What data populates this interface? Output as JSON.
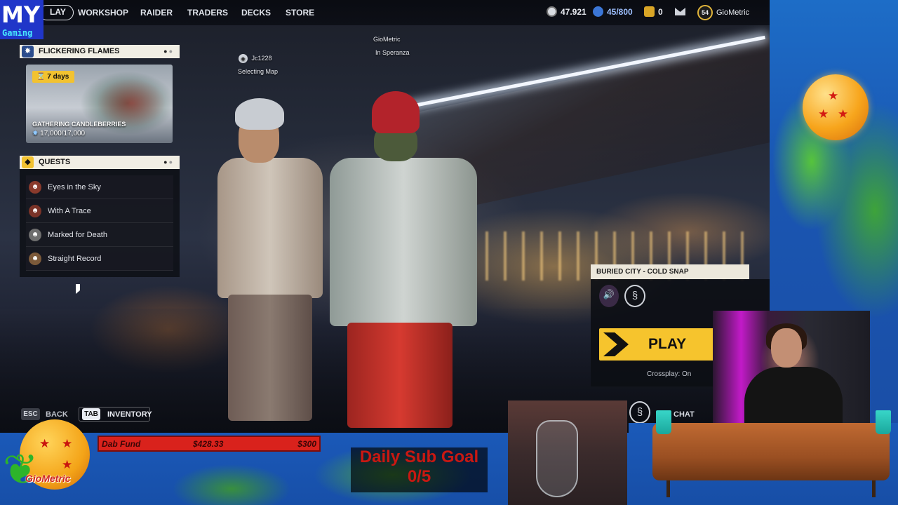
{
  "nav": {
    "play": "LAY",
    "items": [
      "WORKSHOP",
      "RAIDER",
      "TRADERS",
      "DECKS",
      "STORE"
    ],
    "currency1": "47.921",
    "currency2": "45/800",
    "currency3": "0",
    "level": "54",
    "username": "GioMetric"
  },
  "brand": {
    "line1": "MY",
    "line2": "Gaming"
  },
  "event": {
    "header": "FLICKERING FLAMES",
    "timer": "7 days",
    "title": "GATHERING CANDLEBERRIES",
    "progress": "17,000/17,000"
  },
  "quests": {
    "header": "QUESTS",
    "items": [
      {
        "label": "Eyes in the Sky",
        "icon": "portrait-icon"
      },
      {
        "label": "With A Trace",
        "icon": "portrait-icon"
      },
      {
        "label": "Marked for Death",
        "icon": "portrait-icon"
      },
      {
        "label": "Straight Record",
        "icon": "portrait-icon"
      }
    ]
  },
  "players": {
    "p1_name": "Jc1228",
    "p1_status": "Selecting Map",
    "p2_name": "GioMetric",
    "p2_status": "In Speranza"
  },
  "hints": {
    "esc_key": "ESC",
    "esc_label": "BACK",
    "tab_key": "TAB",
    "tab_label": "INVENTORY",
    "chat_label": "CHAT"
  },
  "mode": {
    "title": "BURIED CITY - COLD SNAP",
    "play": "PLAY",
    "crossplay": "Crossplay: On"
  },
  "overlay": {
    "logo_text": "GioMetric",
    "dab_label": "Dab Fund",
    "dab_current": "$428.33",
    "dab_goal": "$300",
    "sub_title": "Daily Sub Goal",
    "sub_count": "0/5"
  },
  "colors": {
    "accent_yellow": "#f6c42d",
    "panel_cream": "#f1eee4",
    "dab_red": "#d9221c",
    "overlay_blue": "#1b59b8",
    "logo_blue": "#2036c9"
  }
}
